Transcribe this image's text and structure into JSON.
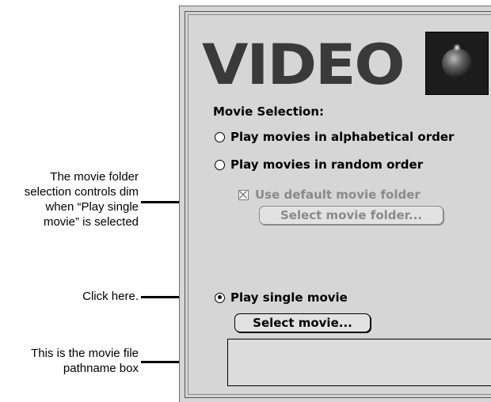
{
  "callouts": {
    "dim_note": [
      "The movie folder",
      "selection controls dim",
      "when “Play single",
      "movie” is selected"
    ],
    "click_note": "Click here.",
    "pathname_note": [
      "This is the movie file",
      "pathname box"
    ]
  },
  "panel": {
    "title": "VIDEO",
    "logo_icon": "video-logo-icon",
    "section_label": "Movie Selection:",
    "options": {
      "alphabetical": "Play movies in alphabetical order",
      "random": "Play movies in random order",
      "single": "Play single movie"
    },
    "selected_option": "single",
    "use_default_folder_label": "Use default movie folder",
    "use_default_folder_checked": true,
    "select_folder_button": "Select movie folder...",
    "select_movie_button": "Select movie...",
    "pathname_value": ""
  }
}
